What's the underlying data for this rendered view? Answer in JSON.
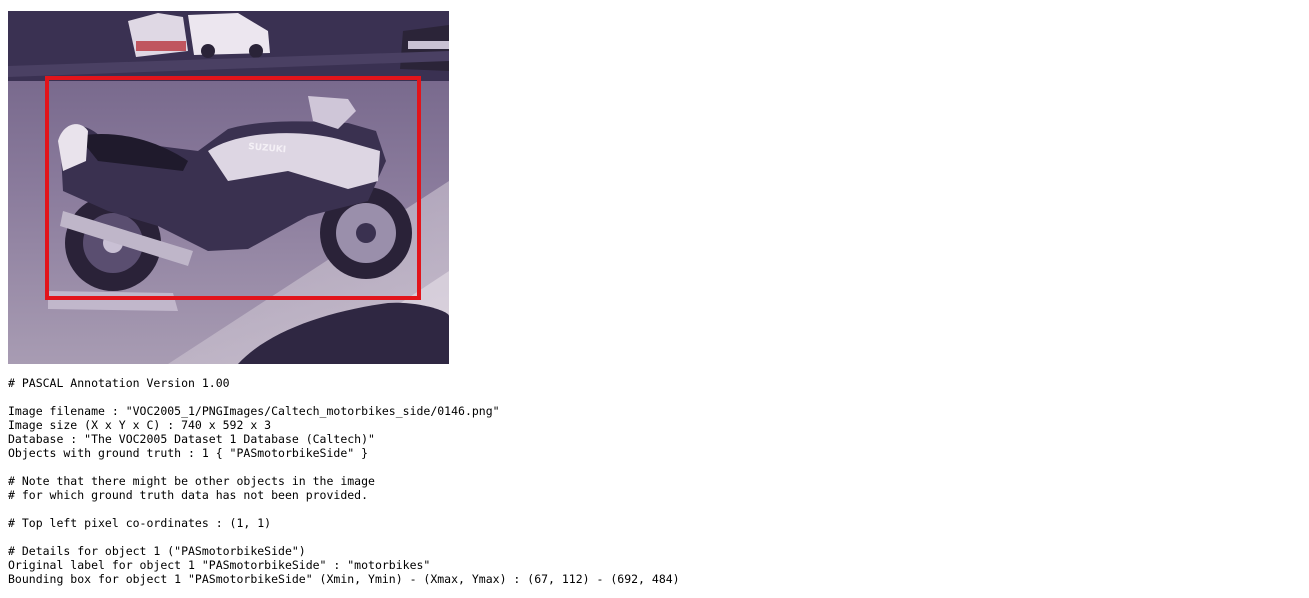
{
  "image": {
    "alt": "Motorbike photo with red bounding box",
    "motorbike_brand_text": "SUZUKI",
    "bbox_color": "#e2141b",
    "photo_tint": "#6c5f82"
  },
  "annotation": {
    "lines": [
      "# PASCAL Annotation Version 1.00",
      "",
      "Image filename : \"VOC2005_1/PNGImages/Caltech_motorbikes_side/0146.png\"",
      "Image size (X x Y x C) : 740 x 592 x 3",
      "Database : \"The VOC2005 Dataset 1 Database (Caltech)\"",
      "Objects with ground truth : 1 { \"PASmotorbikeSide\" }",
      "",
      "# Note that there might be other objects in the image",
      "# for which ground truth data has not been provided.",
      "",
      "# Top left pixel co-ordinates : (1, 1)",
      "",
      "# Details for object 1 (\"PASmotorbikeSide\")",
      "Original label for object 1 \"PASmotorbikeSide\" : \"motorbikes\"",
      "Bounding box for object 1 \"PASmotorbikeSide\" (Xmin, Ymin) - (Xmax, Ymax) : (67, 112) - (692, 484)"
    ]
  }
}
